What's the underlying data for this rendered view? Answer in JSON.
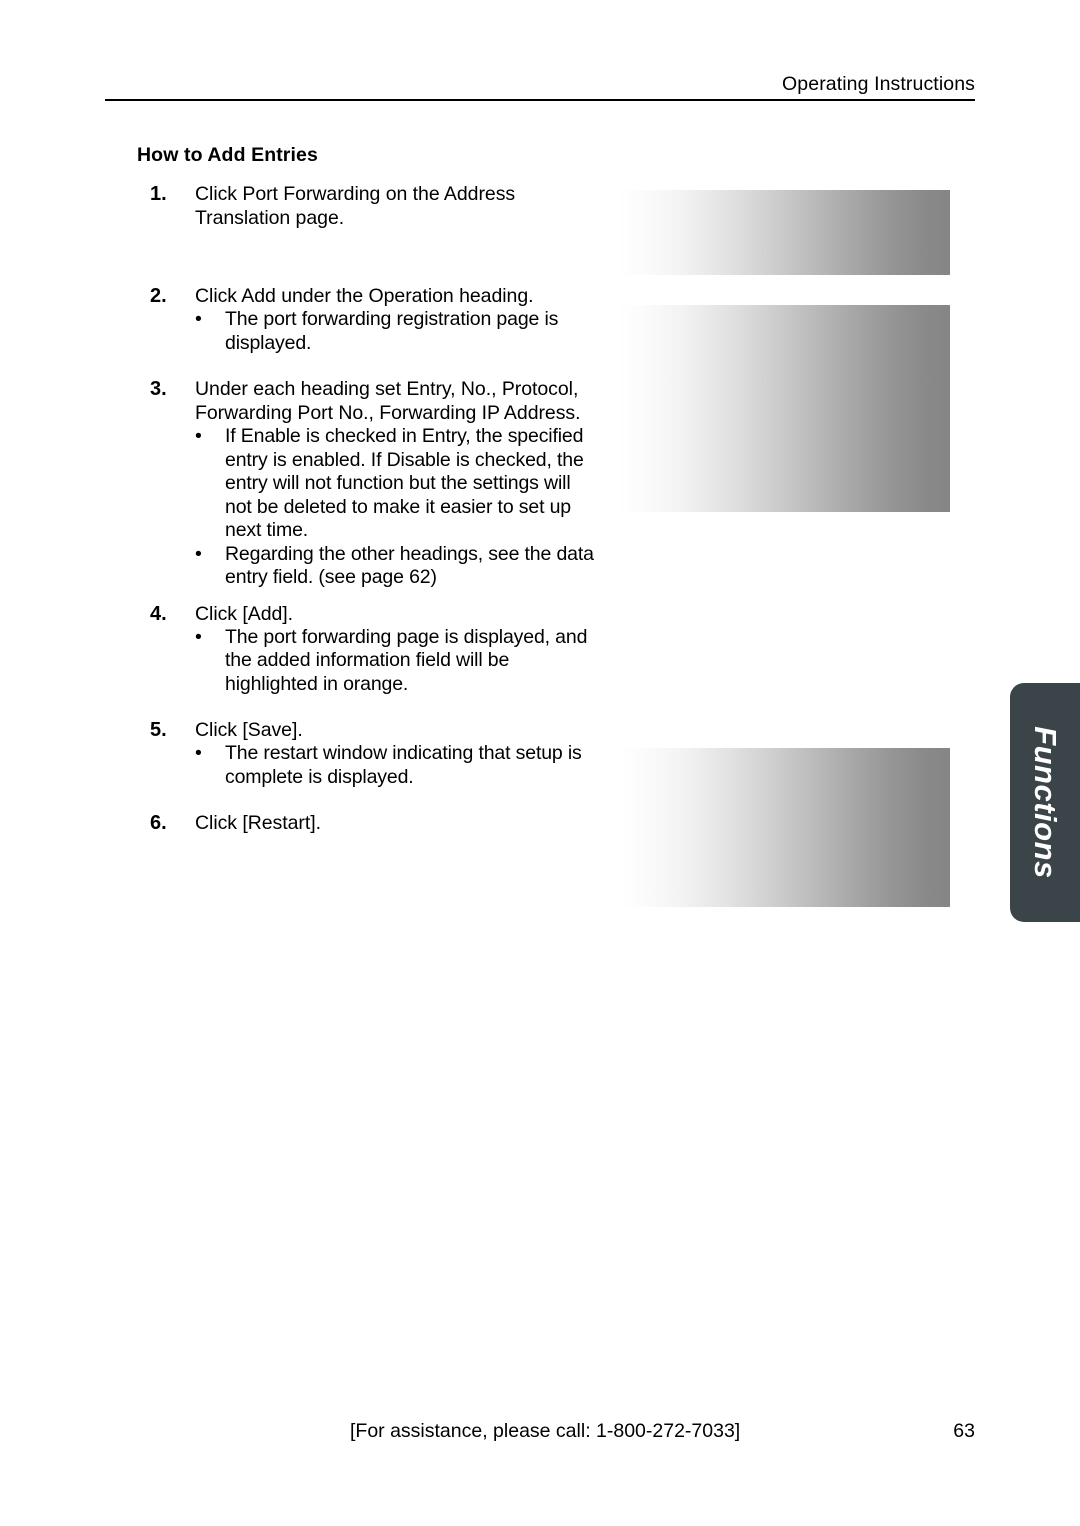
{
  "header": {
    "title": "Operating Instructions"
  },
  "section": {
    "heading": "How to Add Entries"
  },
  "steps": [
    {
      "number": "1.",
      "text": "Click Port Forwarding on the Address Translation page.",
      "bullets": []
    },
    {
      "number": "2.",
      "text": "Click Add under the Operation heading.",
      "bullets": [
        "The port forwarding registration page is displayed."
      ]
    },
    {
      "number": "3.",
      "text": "Under each heading set Entry, No., Protocol, Forwarding Port No., Forwarding IP Address.",
      "bullets": [
        "If Enable is checked in Entry, the specified entry is enabled. If Disable is checked, the entry will not function but the settings will not be deleted to make it easier to set up next time.",
        "Regarding the other headings, see the data entry field. (see page 62)"
      ]
    },
    {
      "number": "4.",
      "text": "Click [Add].",
      "bullets": [
        "The port forwarding page is displayed, and the added information field will be highlighted in orange."
      ]
    },
    {
      "number": "5.",
      "text": "Click [Save].",
      "bullets": [
        "The restart window indicating that setup is complete is displayed."
      ]
    },
    {
      "number": "6.",
      "text": "Click [Restart].",
      "bullets": []
    }
  ],
  "bullet_glyph": "•",
  "screenshots": [
    {
      "name": "address-translation-page-screenshot"
    },
    {
      "name": "port-forwarding-registration-page-screenshot"
    },
    {
      "name": "restart-window-screenshot"
    }
  ],
  "side_tab": {
    "label": "Functions",
    "color": "#3b4449",
    "text_color": "#ffffff"
  },
  "footer": {
    "assistance": "[For assistance, please call: 1-800-272-7033]",
    "page_number": "63"
  }
}
